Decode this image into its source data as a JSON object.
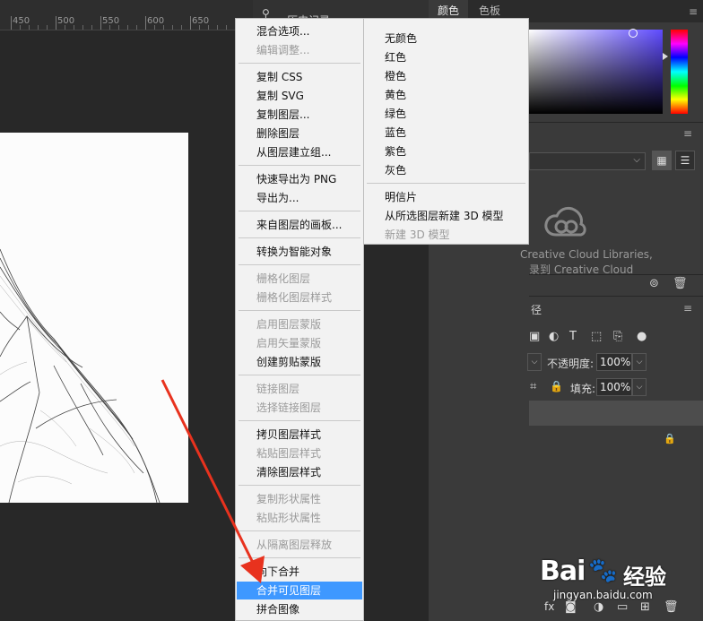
{
  "ruler": {
    "marks": [
      "450",
      "500",
      "550",
      "600",
      "650"
    ]
  },
  "panel_tabs": {
    "history": "历史记录",
    "color": "颜色",
    "swatches": "色板"
  },
  "colors": {
    "menu_highlight": "#3e98ff",
    "arrow": "#e8321e",
    "menu_bg": "#f2f2f2"
  },
  "libraries": {
    "text_line1": "Creative Cloud Libraries,",
    "text_line2": "录到 Creative Cloud"
  },
  "layers_panel": {
    "tab_fragment": "径",
    "opacity_label": "不透明度:",
    "opacity_value": "100%",
    "fill_label": "填充:",
    "fill_value": "100%",
    "fx_label": "fx"
  },
  "context_menu": {
    "items": [
      {
        "label": "混合选项...",
        "enabled": true
      },
      {
        "label": "编辑调整...",
        "enabled": false
      },
      {
        "label": "复制 CSS",
        "enabled": true
      },
      {
        "label": "复制 SVG",
        "enabled": true
      },
      {
        "label": "复制图层...",
        "enabled": true
      },
      {
        "label": "删除图层",
        "enabled": true
      },
      {
        "label": "从图层建立组...",
        "enabled": true
      },
      {
        "label": "快速导出为 PNG",
        "enabled": true
      },
      {
        "label": "导出为...",
        "enabled": true
      },
      {
        "label": "来自图层的画板...",
        "enabled": true
      },
      {
        "label": "转换为智能对象",
        "enabled": true
      },
      {
        "label": "栅格化图层",
        "enabled": false
      },
      {
        "label": "栅格化图层样式",
        "enabled": false
      },
      {
        "label": "启用图层蒙版",
        "enabled": false
      },
      {
        "label": "启用矢量蒙版",
        "enabled": false
      },
      {
        "label": "创建剪贴蒙版",
        "enabled": true
      },
      {
        "label": "链接图层",
        "enabled": false
      },
      {
        "label": "选择链接图层",
        "enabled": false
      },
      {
        "label": "拷贝图层样式",
        "enabled": true
      },
      {
        "label": "粘贴图层样式",
        "enabled": false
      },
      {
        "label": "清除图层样式",
        "enabled": true
      },
      {
        "label": "复制形状属性",
        "enabled": false
      },
      {
        "label": "粘贴形状属性",
        "enabled": false
      },
      {
        "label": "从隔离图层释放",
        "enabled": false
      },
      {
        "label": "向下合并",
        "enabled": true
      },
      {
        "label": "合并可见图层",
        "enabled": true,
        "highlighted": true
      },
      {
        "label": "拼合图像",
        "enabled": true
      }
    ]
  },
  "color_submenu": {
    "items": [
      {
        "label": "无颜色",
        "enabled": true
      },
      {
        "label": "红色",
        "enabled": true
      },
      {
        "label": "橙色",
        "enabled": true
      },
      {
        "label": "黄色",
        "enabled": true
      },
      {
        "label": "绿色",
        "enabled": true
      },
      {
        "label": "蓝色",
        "enabled": true
      },
      {
        "label": "紫色",
        "enabled": true
      },
      {
        "label": "灰色",
        "enabled": true
      },
      {
        "label": "明信片",
        "enabled": true
      },
      {
        "label": "从所选图层新建 3D 模型",
        "enabled": true
      },
      {
        "label": "新建 3D 模型",
        "enabled": false
      }
    ]
  },
  "watermark": {
    "brand": "Bai",
    "brand2": "经验",
    "url": "jingyan.baidu.com"
  }
}
